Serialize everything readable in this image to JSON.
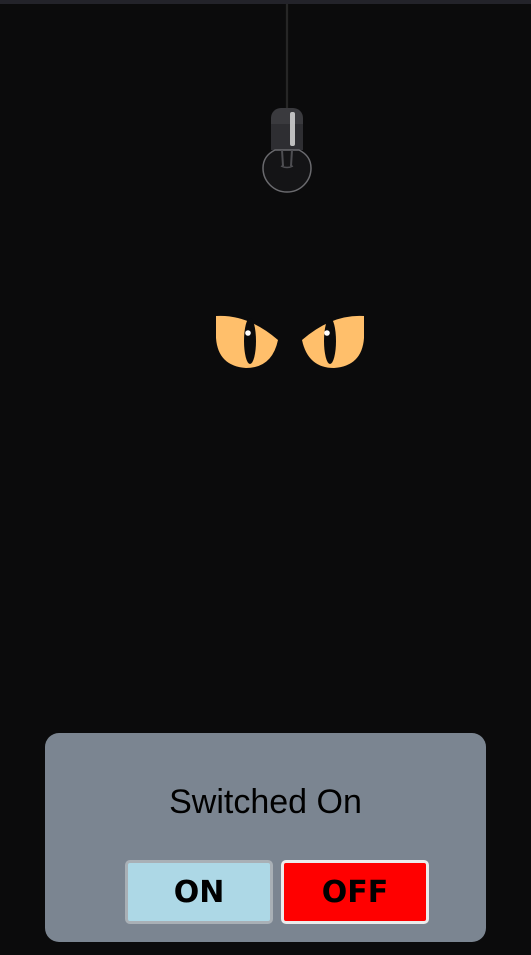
{
  "status_text": "Switched On",
  "buttons": {
    "on_label": "ON",
    "off_label": "OFF"
  },
  "colors": {
    "background": "#0b0b0c",
    "panel": "#7b8591",
    "on_button": "#add8e6",
    "off_button": "#ff0000",
    "eye": "#ffbf6b"
  },
  "icons": {
    "lamp": "light-bulb-icon",
    "eyes": "cat-eyes-icon"
  }
}
